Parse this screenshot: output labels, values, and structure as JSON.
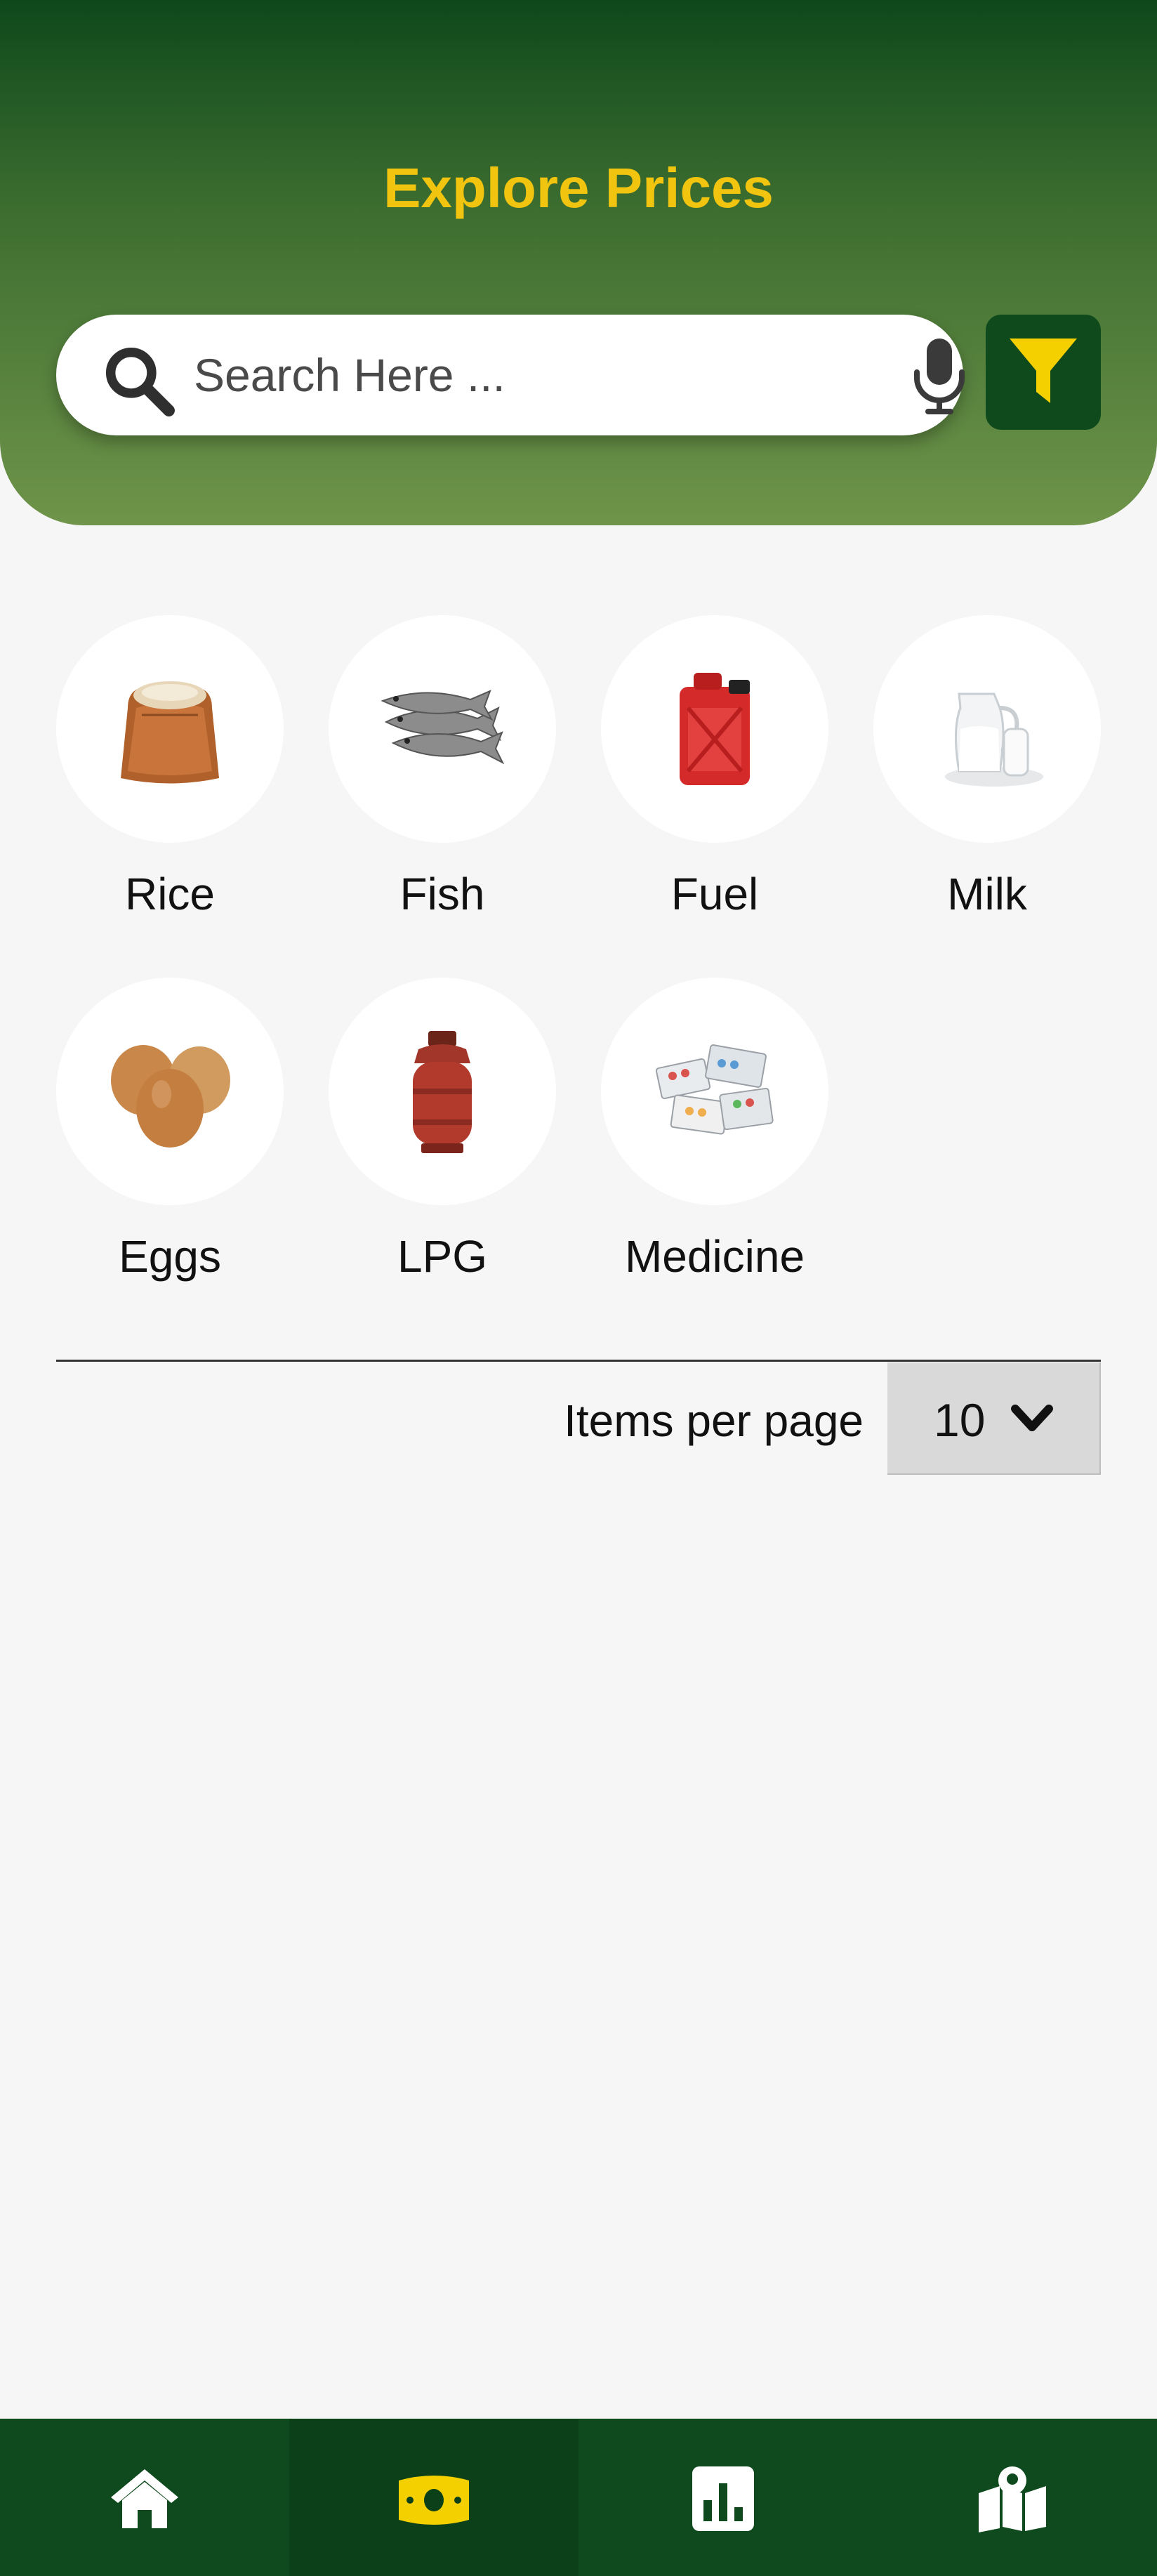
{
  "header": {
    "title": "Explore Prices",
    "search_placeholder": "Search Here ..."
  },
  "colors": {
    "header_dark": "#0e481b",
    "header_light": "#6f944a",
    "title": "#f1c40f",
    "nav_bg": "#0e4a1d",
    "active_icon": "#f5d000"
  },
  "categories": [
    {
      "label": "Rice",
      "icon": "rice-sack-icon"
    },
    {
      "label": "Fish",
      "icon": "fish-icon"
    },
    {
      "label": "Fuel",
      "icon": "fuel-jerrycan-icon"
    },
    {
      "label": "Milk",
      "icon": "milk-jug-icon"
    },
    {
      "label": "Eggs",
      "icon": "eggs-icon"
    },
    {
      "label": "LPG",
      "icon": "gas-cylinder-icon"
    },
    {
      "label": "Medicine",
      "icon": "medicine-pills-icon"
    }
  ],
  "pagination": {
    "items_per_page_label": "Items per page",
    "items_per_page_value": "10"
  },
  "bottom_nav": [
    {
      "icon": "home-icon",
      "active": false
    },
    {
      "icon": "money-icon",
      "active": true
    },
    {
      "icon": "bar-chart-icon",
      "active": false
    },
    {
      "icon": "map-icon",
      "active": false
    }
  ]
}
